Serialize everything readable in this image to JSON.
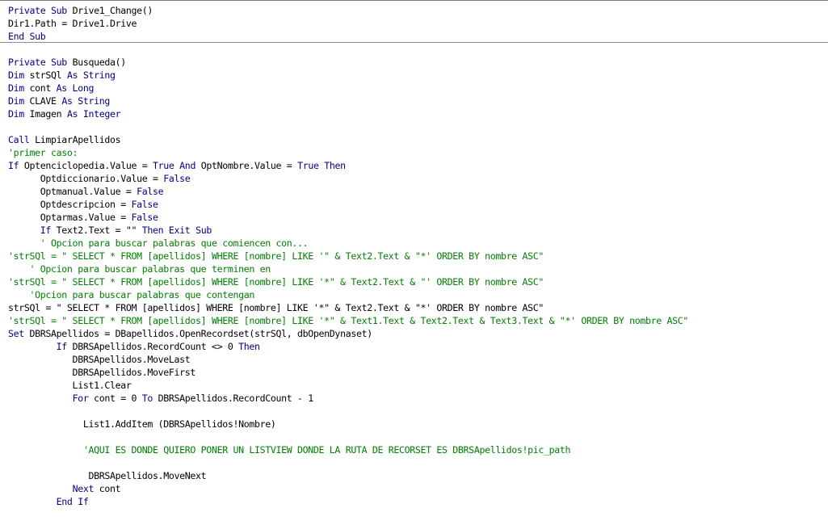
{
  "colors": {
    "background": "#ffffff",
    "keyword": "#00008b",
    "comment": "#008000",
    "text": "#000000",
    "separator": "#8c8c8c"
  },
  "code": {
    "lines": [
      [
        {
          "t": "Private Sub",
          "c": "kw"
        },
        {
          "t": " Drive1_Change()",
          "c": "tx"
        }
      ],
      [
        {
          "t": "Dir1.Path = Drive1.Drive",
          "c": "tx"
        }
      ],
      [
        {
          "t": "End Sub",
          "c": "kw"
        }
      ],
      [],
      [
        {
          "t": "Private Sub",
          "c": "kw"
        },
        {
          "t": " Busqueda()",
          "c": "tx"
        }
      ],
      [
        {
          "t": "Dim",
          "c": "kw"
        },
        {
          "t": " strSQl ",
          "c": "tx"
        },
        {
          "t": "As String",
          "c": "kw"
        }
      ],
      [
        {
          "t": "Dim",
          "c": "kw"
        },
        {
          "t": " cont ",
          "c": "tx"
        },
        {
          "t": "As Long",
          "c": "kw"
        }
      ],
      [
        {
          "t": "Dim",
          "c": "kw"
        },
        {
          "t": " CLAVE ",
          "c": "tx"
        },
        {
          "t": "As String",
          "c": "kw"
        }
      ],
      [
        {
          "t": "Dim",
          "c": "kw"
        },
        {
          "t": " Imagen ",
          "c": "tx"
        },
        {
          "t": "As Integer",
          "c": "kw"
        }
      ],
      [],
      [
        {
          "t": "Call",
          "c": "kw"
        },
        {
          "t": " LimpiarApellidos",
          "c": "tx"
        }
      ],
      [
        {
          "t": "'primer caso:",
          "c": "cm"
        }
      ],
      [
        {
          "t": "If",
          "c": "kw"
        },
        {
          "t": " Optenciclopedia.Value = ",
          "c": "tx"
        },
        {
          "t": "True And",
          "c": "kw"
        },
        {
          "t": " OptNombre.Value = ",
          "c": "tx"
        },
        {
          "t": "True Then",
          "c": "kw"
        }
      ],
      [
        {
          "t": "      Optdiccionario.Value = ",
          "c": "tx"
        },
        {
          "t": "False",
          "c": "kw"
        }
      ],
      [
        {
          "t": "      Optmanual.Value = ",
          "c": "tx"
        },
        {
          "t": "False",
          "c": "kw"
        }
      ],
      [
        {
          "t": "      Optdescripcion = ",
          "c": "tx"
        },
        {
          "t": "False",
          "c": "kw"
        }
      ],
      [
        {
          "t": "      Optarmas.Value = ",
          "c": "tx"
        },
        {
          "t": "False",
          "c": "kw"
        }
      ],
      [
        {
          "t": "      ",
          "c": "tx"
        },
        {
          "t": "If",
          "c": "kw"
        },
        {
          "t": " Text2.Text = \"\" ",
          "c": "tx"
        },
        {
          "t": "Then Exit Sub",
          "c": "kw"
        }
      ],
      [
        {
          "t": "      ' Opcion para buscar palabras que comiencen con...",
          "c": "cm"
        }
      ],
      [
        {
          "t": "'strSQl = \" SELECT * FROM [apellidos] WHERE [nombre] LIKE '\" & Text2.Text & \"*' ORDER BY nombre ASC\"",
          "c": "cm"
        }
      ],
      [
        {
          "t": "    ' Opcion para buscar palabras que terminen en",
          "c": "cm"
        }
      ],
      [
        {
          "t": "'strSQl = \" SELECT * FROM [apellidos] WHERE [nombre] LIKE '*\" & Text2.Text & \"' ORDER BY nombre ASC\"",
          "c": "cm"
        }
      ],
      [
        {
          "t": "    'Opcion para buscar palabras que contengan",
          "c": "cm"
        }
      ],
      [
        {
          "t": "strSQl = \" SELECT * FROM [apellidos] WHERE [nombre] LIKE '*\" & Text2.Text & \"*' ORDER BY nombre ASC\"",
          "c": "tx"
        }
      ],
      [
        {
          "t": "'strSQl = \" SELECT * FROM [apellidos] WHERE [nombre] LIKE '*\" & Text1.Text & Text2.Text & Text3.Text & \"*' ORDER BY nombre ASC\"",
          "c": "cm"
        }
      ],
      [
        {
          "t": "Set",
          "c": "kw"
        },
        {
          "t": " DBRSApellidos = DBapellidos.OpenRecordset(strSQl, dbOpenDynaset)",
          "c": "tx"
        }
      ],
      [
        {
          "t": "         ",
          "c": "tx"
        },
        {
          "t": "If",
          "c": "kw"
        },
        {
          "t": " DBRSApellidos.RecordCount <> 0 ",
          "c": "tx"
        },
        {
          "t": "Then",
          "c": "kw"
        }
      ],
      [
        {
          "t": "            DBRSApellidos.MoveLast",
          "c": "tx"
        }
      ],
      [
        {
          "t": "            DBRSApellidos.MoveFirst",
          "c": "tx"
        }
      ],
      [
        {
          "t": "            List1.Clear",
          "c": "tx"
        }
      ],
      [
        {
          "t": "            ",
          "c": "tx"
        },
        {
          "t": "For",
          "c": "kw"
        },
        {
          "t": " cont = 0 ",
          "c": "tx"
        },
        {
          "t": "To",
          "c": "kw"
        },
        {
          "t": " DBRSApellidos.RecordCount - 1",
          "c": "tx"
        }
      ],
      [],
      [
        {
          "t": "              List1.AddItem (DBRSApellidos!Nombre)",
          "c": "tx"
        }
      ],
      [],
      [
        {
          "t": "              'AQUI ES DONDE QUIERO PONER UN LISTVIEW DONDE LA RUTA DE RECORSET ES DBRSApellidos!pic_path",
          "c": "cm"
        }
      ],
      [],
      [
        {
          "t": "               DBRSApellidos.MoveNext",
          "c": "tx"
        }
      ],
      [
        {
          "t": "            ",
          "c": "tx"
        },
        {
          "t": "Next",
          "c": "kw"
        },
        {
          "t": " cont",
          "c": "tx"
        }
      ],
      [
        {
          "t": "         ",
          "c": "tx"
        },
        {
          "t": "End If",
          "c": "kw"
        }
      ]
    ]
  }
}
